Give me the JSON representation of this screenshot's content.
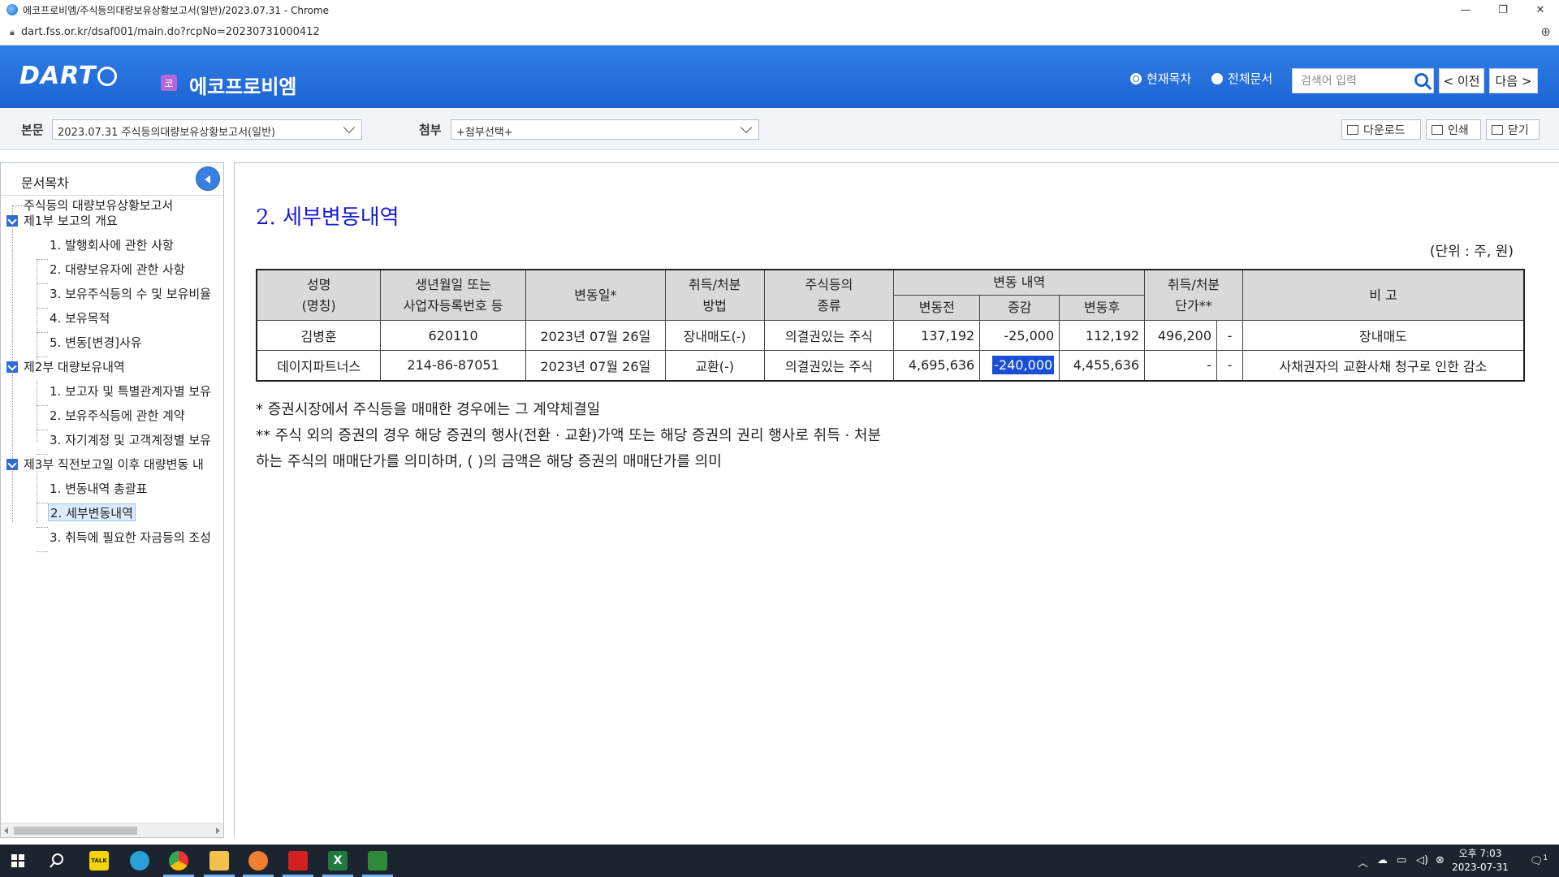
{
  "browser": {
    "title": "에코프로비엠/주식등의대량보유상황보고서(일반)/2023.07.31 - Chrome",
    "url": "dart.fss.or.kr/dsaf001/main.do?rcpNo=20230731000412"
  },
  "header": {
    "logo": "DART",
    "company_badge": "코",
    "company_name": "에코프로비엠",
    "radio_current": "현재목차",
    "radio_all": "전체문서",
    "search_placeholder": "검색어 입력",
    "prev_label": "< 이전",
    "next_label": "다음 >"
  },
  "toolbar": {
    "doc_label": "본문",
    "doc_value": "2023.07.31   주식등의대량보유상황보고서(일반)",
    "attach_label": "첨부",
    "attach_value": "+첨부선택+",
    "download_label": "다운로드",
    "print_label": "인쇄",
    "close_label": "닫기"
  },
  "sidebar": {
    "title": "문서목차",
    "items": [
      "주식등의 대량보유상황보고서",
      "제1부 보고의 개요",
      "1. 발행회사에 관한 사항",
      "2. 대량보유자에 관한 사항",
      "3. 보유주식등의 수 및 보유비율",
      "4. 보유목적",
      "5. 변동[변경]사유",
      "제2부 대량보유내역",
      "1. 보고자 및 특별관계자별 보유",
      "2. 보유주식등에 관한 계약",
      "3. 자기계정 및 고객계정별 보유",
      "제3부 직전보고일 이후 대량변동 내",
      "1. 변동내역 총괄표",
      "2. 세부변동내역",
      "3. 취득에 필요한 자금등의 조성"
    ]
  },
  "main": {
    "section_title": "2. 세부변동내역",
    "unit": "(단위 : 주, 원)",
    "headers": {
      "name_1": "성명",
      "name_2": "(명칭)",
      "birth_1": "생년월일 또는",
      "birth_2": "사업자등록번호 등",
      "date": "변동일*",
      "method_1": "취득/처분",
      "method_2": "방법",
      "kind_1": "주식등의",
      "kind_2": "종류",
      "change": "변동 내역",
      "before": "변동전",
      "delta": "증감",
      "after": "변동후",
      "price_1": "취득/처분",
      "price_2": "단가**",
      "note": "비 고"
    },
    "rows": [
      {
        "name": "김병훈",
        "id": "620110",
        "date": "2023년 07월 26일",
        "method": "장내매도(-)",
        "kind": "의결권있는 주식",
        "before": "137,192",
        "delta": "-25,000",
        "after": "112,192",
        "price": "496,200",
        "price2": "-",
        "note": "장내매도"
      },
      {
        "name": "데이지파트너스",
        "id": "214-86-87051",
        "date": "2023년 07월 26일",
        "method": "교환(-)",
        "kind": "의결권있는 주식",
        "before": "4,695,636",
        "delta": "-240,000",
        "after": "4,455,636",
        "price": "-",
        "price2": "-",
        "note": "사채권자의 교환사채 청구로 인한 감소"
      }
    ],
    "notes": [
      "*   증권시장에서 주식등을 매매한 경우에는 그 계약체결일",
      "** 주식 외의 증권의 경우 해당 증권의 행사(전환 · 교환)가액 또는 해당 증권의 권리 행사로 취득 · 처분하는 주식의 매매단가를 의미하며, (   )의 금액은 해당 증권의 매매단가를 의미"
    ]
  },
  "taskbar": {
    "clock_line1": "오후 7:03",
    "clock_line2": "2023-07-31",
    "kakao_label": "TALK",
    "excel_label": "X",
    "notify_count": "1"
  }
}
